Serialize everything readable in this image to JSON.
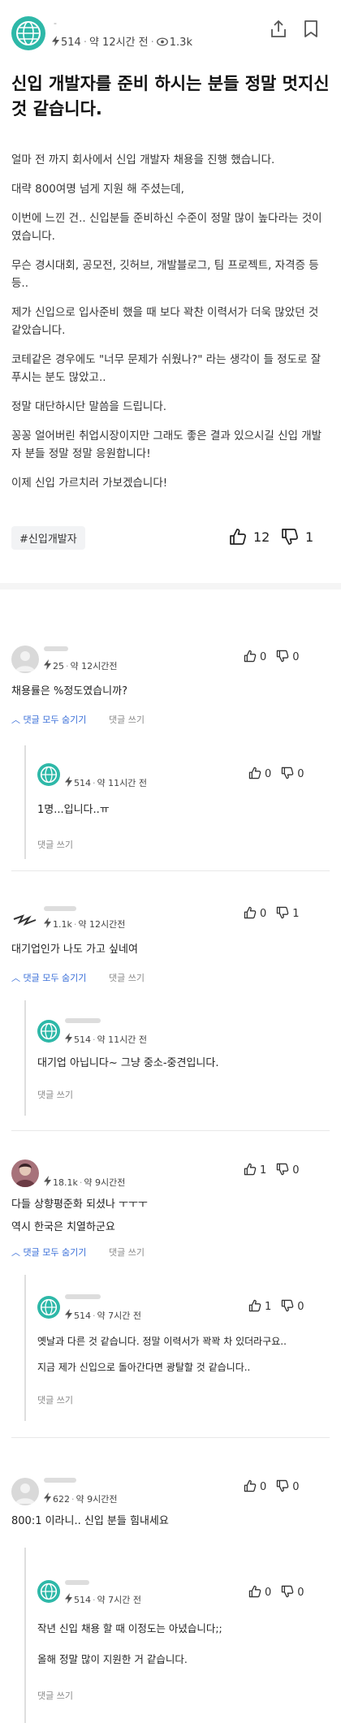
{
  "post": {
    "author_points": "514",
    "time": "약 12시간 전",
    "views": "1.3k",
    "title": "신입 개발자를 준비 하시는 분들 정말 멋지신 것 같습니다.",
    "paragraphs": [
      "얼마 전 까지 회사에서 신입 개발자 채용을 진행 했습니다.",
      "대략 800여명 넘게 지원 해 주셨는데,",
      "이번에 느낀 건.. 신입분들 준비하신 수준이 정말 많이 높다라는 것이였습니다.",
      "무슨 경시대회, 공모전, 깃허브, 개발블로그, 팀 프로젝트, 자격증 등등..",
      "제가 신입으로 입사준비 했을 때 보다 꽉찬 이력서가 더욱 많았던 것 같았습니다.",
      "코테같은 경우에도 \"너무 문제가 쉬웠나?\" 라는 생각이 들 정도로 잘 푸시는 분도 많았고..",
      "정말 대단하시단 말씀을 드립니다.",
      "꽁꽁 얼어버린 취업시장이지만 그래도 좋은 결과 있으시길 신입 개발자 분들 정말 정말 응원합니다!",
      "이제 신입 가르치러 가보겠습니다!"
    ],
    "tag": "#신입개발자",
    "likes": "12",
    "dislikes": "1"
  },
  "comments": [
    {
      "points": "25",
      "time": "약 12시간전",
      "text": "채용률은 %정도였습니까?",
      "up": "0",
      "down": "0",
      "toggle": "댓글 모두 숨기기",
      "write": "댓글 쓰기",
      "reply": {
        "points": "514",
        "time": "약 11시간 전",
        "text": "1명...입니다..ㅠ",
        "up": "0",
        "down": "0",
        "write": "댓글 쓰기"
      }
    },
    {
      "points": "1.1k",
      "time": "약 12시간전",
      "text": "대기업인가 나도 가고 싶네여",
      "up": "0",
      "down": "1",
      "toggle": "댓글 모두 숨기기",
      "write": "댓글 쓰기",
      "reply": {
        "points": "514",
        "time": "약 11시간 전",
        "text": "대기업 아닙니다~ 그냥 중소-중견입니다.",
        "up": "0",
        "down": "0",
        "write": "댓글 쓰기"
      }
    },
    {
      "points": "18.1k",
      "time": "약 9시간전",
      "text": "다들 상향평준화 되셨나 ㅜㅜㅜ",
      "text2": "역시 한국은 치열하군요",
      "up": "1",
      "down": "0",
      "toggle": "댓글 모두 숨기기",
      "write": "댓글 쓰기",
      "reply": {
        "points": "514",
        "time": "약 7시간 전",
        "text": "옛날과 다른 것 같습니다. 정말 이력서가 꽉꽉 차 있더라구요..",
        "text2": "지금 제가 신입으로 돌아간다면 광탈할 것 같습니다..",
        "up": "1",
        "down": "0",
        "write": "댓글 쓰기"
      }
    },
    {
      "points": "622",
      "time": "약 9시간전",
      "text": "800:1 이라니.. 신입 분들 힘내세요",
      "up": "0",
      "down": "0",
      "reply": {
        "points": "514",
        "time": "약 7시간 전",
        "text": "작년 신입 채용 할 때 이정도는 아녔습니다;;",
        "text2": "올해 정말 많이 지원한 거 같습니다.",
        "up": "0",
        "down": "0",
        "write": "댓글 쓰기"
      }
    }
  ],
  "colors": {
    "accent_link": "#3a6fd8",
    "avatar_teal": "#2eb8a8"
  },
  "icons": [
    "lightning-icon",
    "eye-icon",
    "share-icon",
    "bookmark-icon",
    "thumbs-up-icon",
    "thumbs-down-icon",
    "chevron-up-icon"
  ]
}
